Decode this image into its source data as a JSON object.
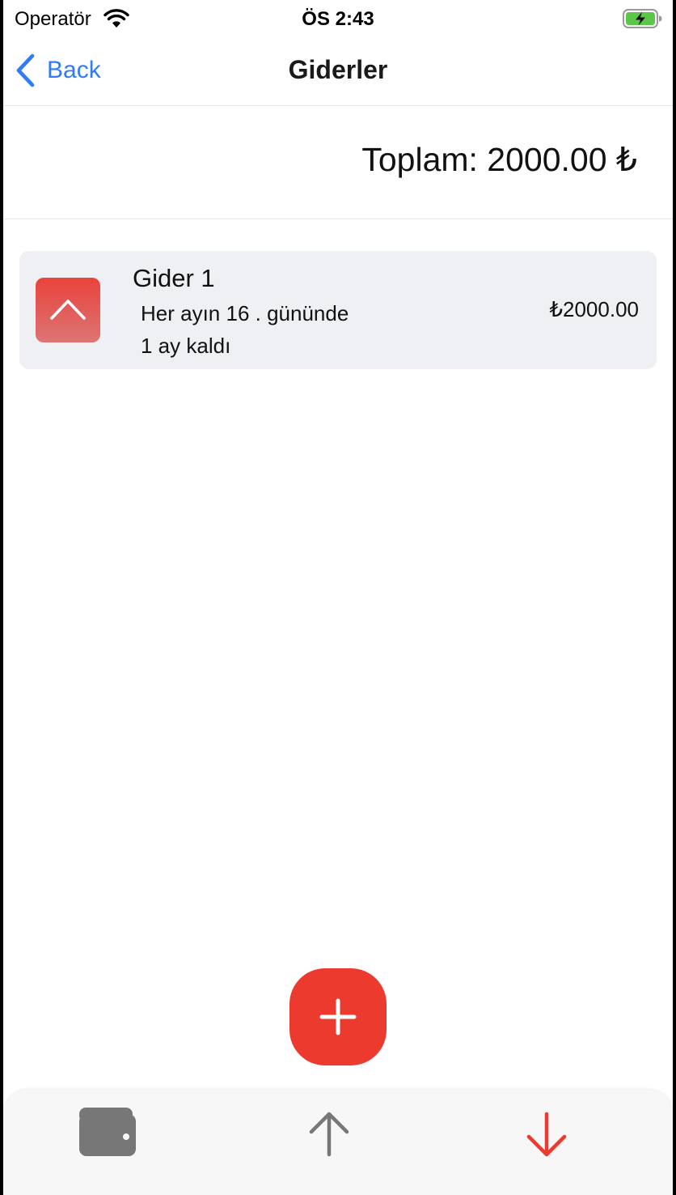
{
  "status_bar": {
    "carrier": "Operatör",
    "time": "ÖS 2:43",
    "icons": [
      "wifi-icon",
      "battery-charging-icon"
    ]
  },
  "nav": {
    "back_label": "Back",
    "title": "Giderler"
  },
  "summary": {
    "total_text": "Toplam: 2000.00 ₺"
  },
  "expenses": [
    {
      "name": "Gider 1",
      "schedule": "Her ayın 16 . gününde",
      "remaining": "1 ay kaldı",
      "amount": "₺2000.00",
      "icon": "chevron-up-icon"
    }
  ],
  "fab": {
    "icon": "plus-icon"
  },
  "tab_bar": {
    "tabs": [
      {
        "icon": "wallet-icon"
      },
      {
        "icon": "arrow-up-icon"
      },
      {
        "icon": "arrow-down-icon",
        "active": true
      }
    ]
  },
  "colors": {
    "accent_blue": "#2f7cf6",
    "accent_red": "#ec3a2f",
    "card_bg": "#eef0f3",
    "tab_inactive": "#777777"
  }
}
